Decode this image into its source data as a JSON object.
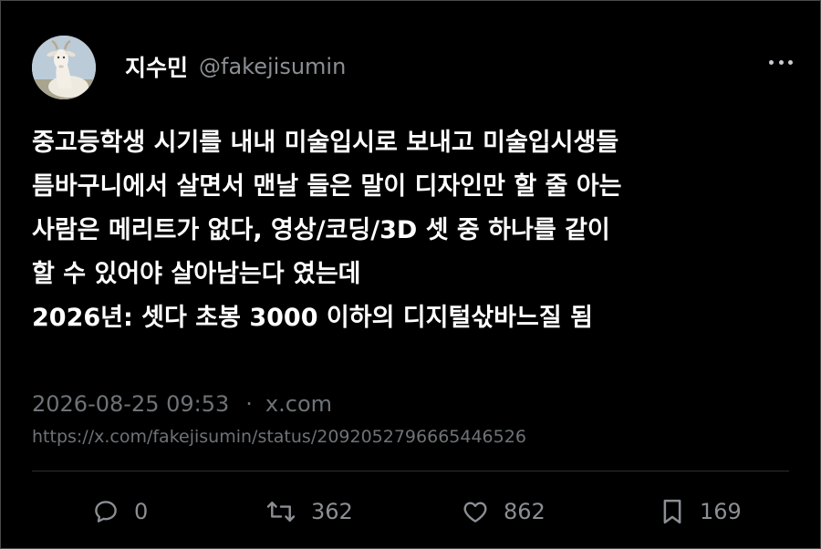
{
  "author": {
    "display_name": "지수민",
    "handle": "@fakejisumin",
    "avatar_icon": "goat-avatar"
  },
  "tweet": {
    "lines": [
      "중고등학생 시기를 내내 미술입시로 보내고 미술입시생들",
      "틈바구니에서 살면서 맨날 들은 말이 디자인만 할 줄 아는",
      "사람은 메리트가 없다, 영상/코딩/3D 셋 중 하나를 같이",
      "할 수 있어야 살아남는다 였는데",
      "2026년: 셋다 초봉 3000 이하의 디지털삯바느질 됨"
    ]
  },
  "meta": {
    "timestamp": "2026-08-25 09:53",
    "separator": "·",
    "source": "x.com",
    "url": "https://x.com/fakejisumin/status/2092052796665446526"
  },
  "actions": {
    "reply": {
      "icon": "reply-bubble-icon",
      "count": "0"
    },
    "retweet": {
      "icon": "retweet-icon",
      "count": "362"
    },
    "like": {
      "icon": "heart-icon",
      "count": "862"
    },
    "bookmark": {
      "icon": "bookmark-icon",
      "count": "169"
    }
  },
  "colors": {
    "background": "#000000",
    "text_primary": "#ffffff",
    "text_secondary": "#6e7377",
    "icon": "#8b8f94"
  }
}
